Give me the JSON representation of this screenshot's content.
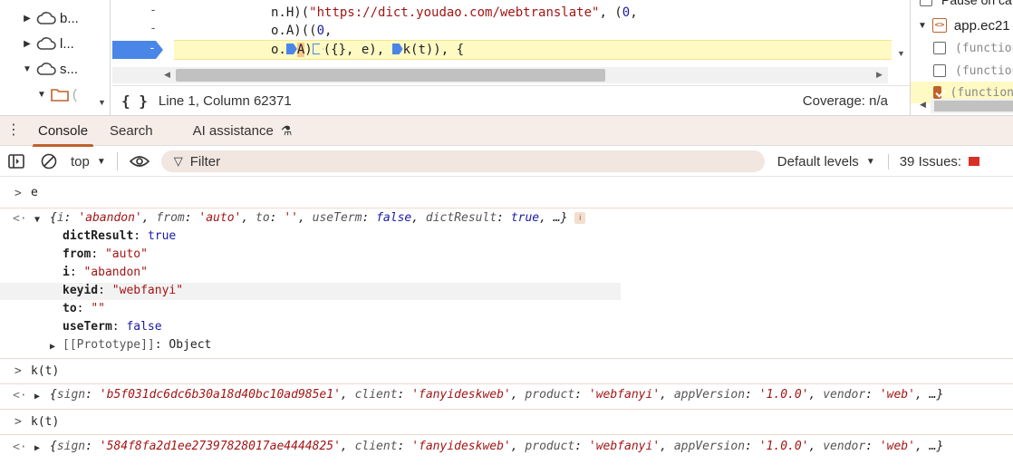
{
  "file_tree": {
    "items": [
      {
        "label": "b..."
      },
      {
        "label": "l..."
      },
      {
        "label": "s..."
      },
      {
        "label": "("
      }
    ]
  },
  "editor": {
    "gutter_dash": "-",
    "lines": [
      {
        "prefix": "n.H)(",
        "url": "\"https://dict.youdao.com/webtranslate\"",
        "suffix": ", (",
        "num": "0",
        "end": ","
      },
      {
        "prefix": "o.A)((",
        "num": "0",
        "end": ","
      },
      {
        "p1": "o.",
        "p2": "A",
        "p3": ")",
        "p4": "({}, e), ",
        "p5": "k(t)), {"
      }
    ],
    "position_text": "Line 1, Column 62371",
    "coverage_text": "Coverage: n/a",
    "braces": "{ }"
  },
  "right_panel": {
    "top_text": "Pause on ca",
    "file_name": "app.ec21",
    "functions": [
      "(function",
      "(function",
      "(function"
    ]
  },
  "drawer": {
    "tabs": [
      {
        "label": "Console"
      },
      {
        "label": "Search"
      },
      {
        "label": "AI assistance"
      }
    ]
  },
  "toolbar": {
    "context": "top",
    "filter_placeholder": "Filter",
    "levels": "Default levels",
    "issues": "39 Issues:"
  },
  "console": {
    "entries": [
      {
        "input": "e"
      },
      {
        "summary": {
          "i": "'abandon'",
          "from": "'auto'",
          "to": "''",
          "useTerm": "false",
          "dictResult": "true",
          "more": "…}"
        },
        "props": [
          {
            "key": "dictResult",
            "value": "true",
            "type": "bool"
          },
          {
            "key": "from",
            "value": "\"auto\"",
            "type": "str"
          },
          {
            "key": "i",
            "value": "\"abandon\"",
            "type": "str"
          },
          {
            "key": "keyid",
            "value": "\"webfanyi\"",
            "type": "str"
          },
          {
            "key": "to",
            "value": "\"\"",
            "type": "str"
          },
          {
            "key": "useTerm",
            "value": "false",
            "type": "bool"
          }
        ],
        "prototype": "[[Prototype]]",
        "prototype_value": "Object"
      },
      {
        "input": "k(t)"
      },
      {
        "sign": "'b5f031dc6dc6b30a18d40bc10ad985e1'",
        "client": "'fanyideskweb'",
        "product": "'webfanyi'",
        "appVersion": "'1.0.0'",
        "vendor": "'web'"
      },
      {
        "input": "k(t)"
      },
      {
        "sign": "'584f8fa2d1ee27397828017ae4444825'",
        "client": "'fanyideskweb'",
        "product": "'webfanyi'",
        "appVersion": "'1.0.0'",
        "vendor": "'web'"
      }
    ]
  }
}
